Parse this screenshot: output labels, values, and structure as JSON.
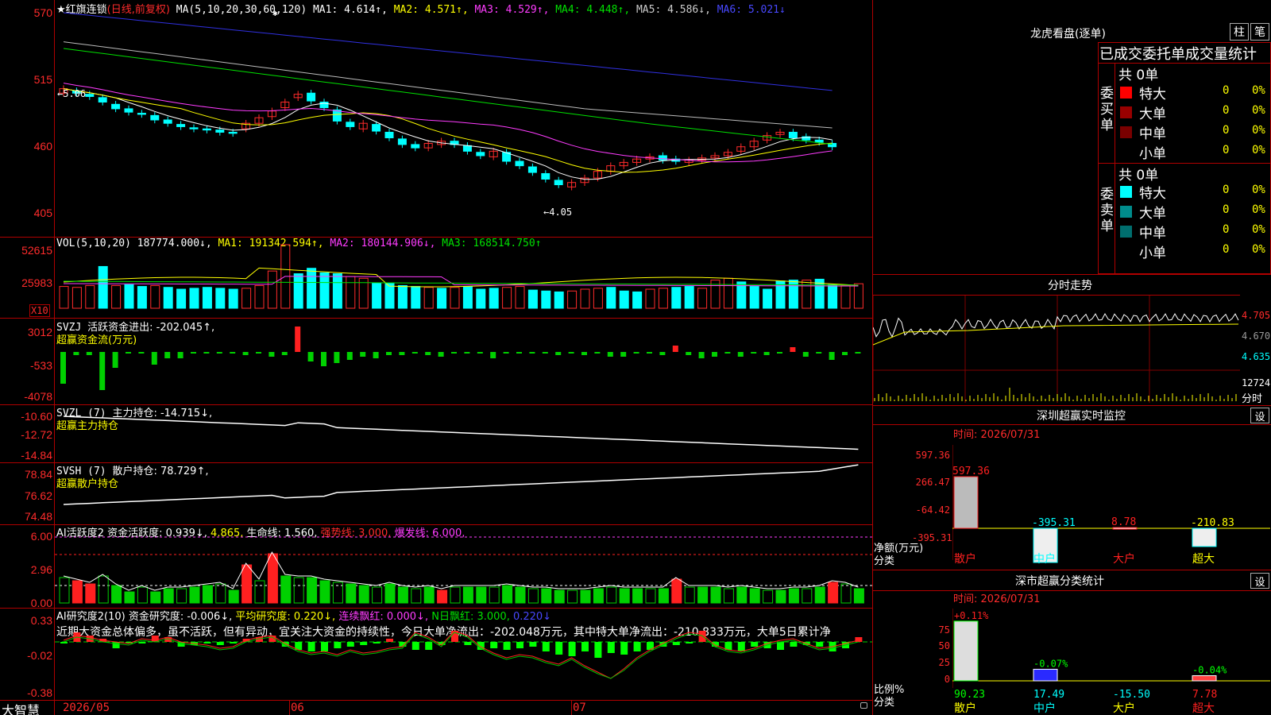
{
  "app_name": "大智慧",
  "stock": {
    "star": "★",
    "name": "红旗连锁",
    "period": "(日线,前复权)"
  },
  "main": {
    "ma_params": "MA(5,10,20,30,60,120)",
    "ma": [
      {
        "label": "MA1: 4.614↑,",
        "color": "#ffffff"
      },
      {
        "label": "MA2: 4.571↑,",
        "color": "#ffff00"
      },
      {
        "label": "MA3: 4.529↑,",
        "color": "#ff3cff"
      },
      {
        "label": "MA4: 4.448↑,",
        "color": "#00e000"
      },
      {
        "label": "MA5: 4.586↓,",
        "color": "#cccccc"
      },
      {
        "label": "MA6: 5.021↓",
        "color": "#4848ff"
      }
    ],
    "y_ticks": [
      "570",
      "515",
      "460",
      "405"
    ],
    "high_label": "←5.06",
    "low_label": "←4.05",
    "marker": "✱"
  },
  "vol": {
    "title": "VOL(5,10,20)",
    "value": "187774.000↓,",
    "ma1": "MA1: 191342.594↑,",
    "ma2": "MA2: 180144.906↓,",
    "ma3": "MA3: 168514.750↑",
    "y_ticks": [
      "52615",
      "25983"
    ],
    "unit": "X10"
  },
  "svzj": {
    "title": "SVZJ",
    "label": "活跃资金进出: -202.045↑,",
    "name": "超赢资金流(万元)",
    "y_ticks": [
      "3012",
      "-533",
      "-4078"
    ]
  },
  "svzl": {
    "title": "SVZL (7)",
    "label": "主力持仓: -14.715↓,",
    "name": "超赢主力持仓",
    "y_ticks": [
      "-10.60",
      "-12.72",
      "-14.84"
    ]
  },
  "svsh": {
    "title": "SVSH (7)",
    "label": "散户持仓: 78.729↑,",
    "name": "超赢散户持仓",
    "y_ticks": [
      "78.84",
      "76.62",
      "74.48"
    ]
  },
  "ai1": {
    "title": "AI活跃度2",
    "label1": "资金活跃度: 0.939↓,",
    "label2": "4.865,",
    "label3": "生命线: 1.560,",
    "label4": "强势线: 3.000,",
    "label5": "爆发线: 6.000,",
    "y_ticks": [
      "6.00",
      "2.96",
      "0.00"
    ]
  },
  "ai2": {
    "title": "AI研究度2(10)",
    "label1": "资金研究度: -0.006↓,",
    "label2": "平均研究度: 0.220↓,",
    "label3": "连续飘红: 0.000↓,",
    "label4": "N日飘红: 3.000,",
    "label5": "0.220↓",
    "commentary": "近期大资金总体偏多，虽不活跃，但有异动，宜关注大资金的持续性，今日大单净流出：-202.048万元，其中特大单净流出：-210.833万元，大单5日累计净",
    "y_ticks": [
      "0.33",
      "-0.02",
      "-0.38"
    ]
  },
  "x_axis": [
    "2026/05",
    "06",
    "07"
  ],
  "dragon": {
    "title": "龙虎看盘(逐单)",
    "btn1": "柱",
    "btn2": "笔",
    "tabs": "已成交委托单成交量统计",
    "buy_label": "委买单",
    "sell_label": "委卖单",
    "buy_total": "共 0单",
    "sell_total": "共 0单",
    "buy_rows": [
      {
        "name": "特大",
        "count": "0",
        "pct": "0%",
        "color": "#ff0000"
      },
      {
        "name": "大单",
        "count": "0",
        "pct": "0%",
        "color": "#990000"
      },
      {
        "name": "中单",
        "count": "0",
        "pct": "0%",
        "color": "#7a0000"
      },
      {
        "name": "小单",
        "count": "0",
        "pct": "0%",
        "color": "#000000"
      }
    ],
    "sell_rows": [
      {
        "name": "特大",
        "count": "0",
        "pct": "0%",
        "color": "#00ffff"
      },
      {
        "name": "大单",
        "count": "0",
        "pct": "0%",
        "color": "#008c8c"
      },
      {
        "name": "中单",
        "count": "0",
        "pct": "0%",
        "color": "#006e6e"
      },
      {
        "name": "小单",
        "count": "0",
        "pct": "0%",
        "color": "#000000"
      }
    ]
  },
  "minute": {
    "title": "分时走势",
    "y_ticks": [
      "4.705",
      "4.670",
      "4.635"
    ],
    "vol_tick": "12724",
    "vol_label": "分时"
  },
  "sz_monitor": {
    "title": "深圳超赢实时监控",
    "setting": "设",
    "time": "时间: 2026/07/31",
    "y_ticks": [
      "597.36",
      "266.47",
      "-64.42",
      "-395.31"
    ],
    "ylabel1": "净额(万元)",
    "ylabel2": "分类",
    "bars": [
      {
        "cat": "散户",
        "value": 597.36,
        "label": "597.36"
      },
      {
        "cat": "中户",
        "value": -395.31,
        "label": "-395.31"
      },
      {
        "cat": "大户",
        "value": 8.78,
        "label": "8.78"
      },
      {
        "cat": "超大",
        "value": -210.83,
        "label": "-210.83"
      }
    ]
  },
  "sz_class": {
    "title": "深市超赢分类统计",
    "setting": "设",
    "time": "时间: 2026/07/31",
    "y_ticks": [
      "75",
      "50",
      "25",
      "0"
    ],
    "ylabel1": "比例%",
    "ylabel2": "分类",
    "bars": [
      {
        "cat": "散户",
        "value": 90.23,
        "label": "90.23",
        "top": "+0.11%"
      },
      {
        "cat": "中户",
        "value": 17.49,
        "label": "17.49",
        "top": "-0.07%"
      },
      {
        "cat": "大户",
        "value": -15.5,
        "label": "-15.50",
        "top": ""
      },
      {
        "cat": "超大",
        "value": 7.78,
        "label": "7.78",
        "top": "-0.04%"
      }
    ]
  },
  "chart_data": [
    {
      "type": "candlestick",
      "title": "红旗连锁 (日线,前复权)",
      "ylim": [
        4.0,
        5.7
      ],
      "x": [
        "2026/05",
        "06",
        "07"
      ],
      "series": [
        {
          "name": "MA6",
          "values": [
            5.7,
            5.02
          ]
        },
        {
          "name": "MA5",
          "values": [
            5.45,
            4.586
          ]
        }
      ],
      "high": 5.06,
      "low": 4.05
    },
    {
      "type": "bar",
      "title": "VOL(5,10,20)",
      "ylim": [
        0,
        52615
      ],
      "categories": [],
      "values": []
    },
    {
      "type": "bar",
      "title": "深圳超赢实时监控",
      "categories": [
        "散户",
        "中户",
        "大户",
        "超大"
      ],
      "values": [
        597.36,
        -395.31,
        8.78,
        -210.83
      ],
      "ylabel": "净额(万元)",
      "ylim": [
        -395.31,
        597.36
      ]
    },
    {
      "type": "bar",
      "title": "深市超赢分类统计",
      "categories": [
        "散户",
        "中户",
        "大户",
        "超大"
      ],
      "values": [
        90.23,
        17.49,
        -15.5,
        7.78
      ],
      "ylabel": "比例%",
      "ylim": [
        0,
        90
      ]
    }
  ]
}
